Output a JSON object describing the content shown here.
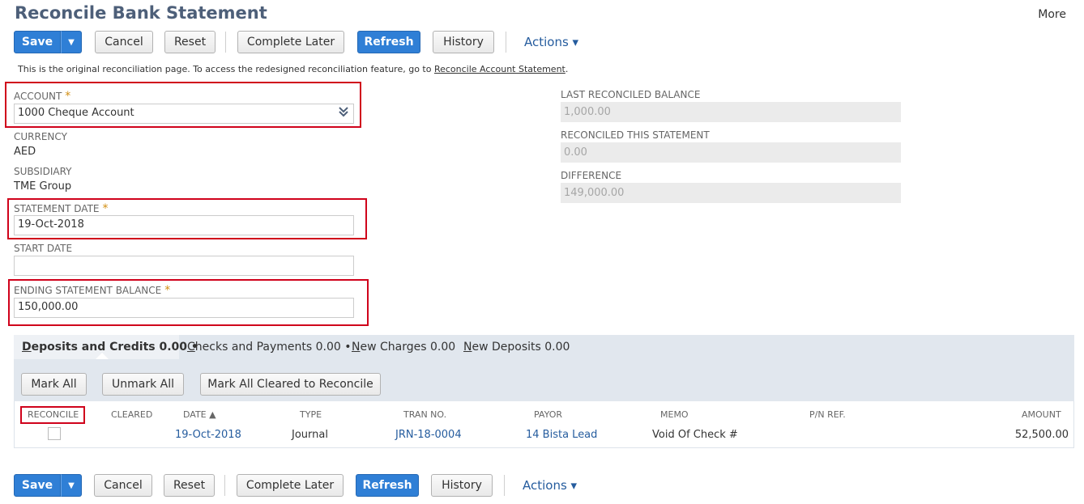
{
  "page": {
    "title": "Reconcile Bank Statement",
    "more": "More"
  },
  "toolbar": {
    "save": "Save",
    "save_arrow": "▼",
    "cancel": "Cancel",
    "reset": "Reset",
    "complete_later": "Complete Later",
    "refresh": "Refresh",
    "history": "History",
    "actions": "Actions ▾"
  },
  "notice": {
    "text": "This is the original reconciliation page. To access the redesigned reconciliation feature, go to ",
    "link": "Reconcile Account Statement",
    "end": "."
  },
  "form": {
    "account": {
      "label": "ACCOUNT",
      "req": "*",
      "value": "1000 Cheque Account"
    },
    "currency": {
      "label": "CURRENCY",
      "value": "AED"
    },
    "subsidiary": {
      "label": "SUBSIDIARY",
      "value": "TME Group"
    },
    "statement_date": {
      "label": "STATEMENT DATE",
      "req": "*",
      "value": "19-Oct-2018"
    },
    "start_date": {
      "label": "START DATE",
      "value": ""
    },
    "ending_balance": {
      "label": "ENDING STATEMENT BALANCE",
      "req": "*",
      "value": "150,000.00"
    }
  },
  "summary": {
    "last_reconciled": {
      "label": "LAST RECONCILED BALANCE",
      "value": "1,000.00"
    },
    "reconciled_this": {
      "label": "RECONCILED THIS STATEMENT",
      "value": "0.00"
    },
    "difference": {
      "label": "DIFFERENCE",
      "value": "149,000.00"
    }
  },
  "tabs": [
    {
      "first": "D",
      "rest": "eposits and Credits 0.00",
      "dot": "•"
    },
    {
      "first": "C",
      "rest": "hecks and Payments 0.00",
      "dot": "•"
    },
    {
      "first": "N",
      "rest": "ew Charges 0.00",
      "dot": ""
    },
    {
      "first": "N",
      "rest": "ew Deposits 0.00",
      "dot": ""
    }
  ],
  "sublist": {
    "mark_all": "Mark All",
    "unmark_all": "Unmark All",
    "mark_cleared": "Mark All Cleared to Reconcile",
    "columns": [
      "RECONCILE",
      "CLEARED",
      "DATE ▲",
      "TYPE",
      "TRAN NO.",
      "PAYOR",
      "MEMO",
      "P/N REF.",
      "AMOUNT"
    ],
    "rows": [
      {
        "date": "19-Oct-2018",
        "type": "Journal",
        "tran_no": "JRN-18-0004",
        "payor": "14 Bista Lead",
        "memo": "Void Of Check #",
        "pn_ref": "",
        "amount": "52,500.00"
      }
    ]
  }
}
